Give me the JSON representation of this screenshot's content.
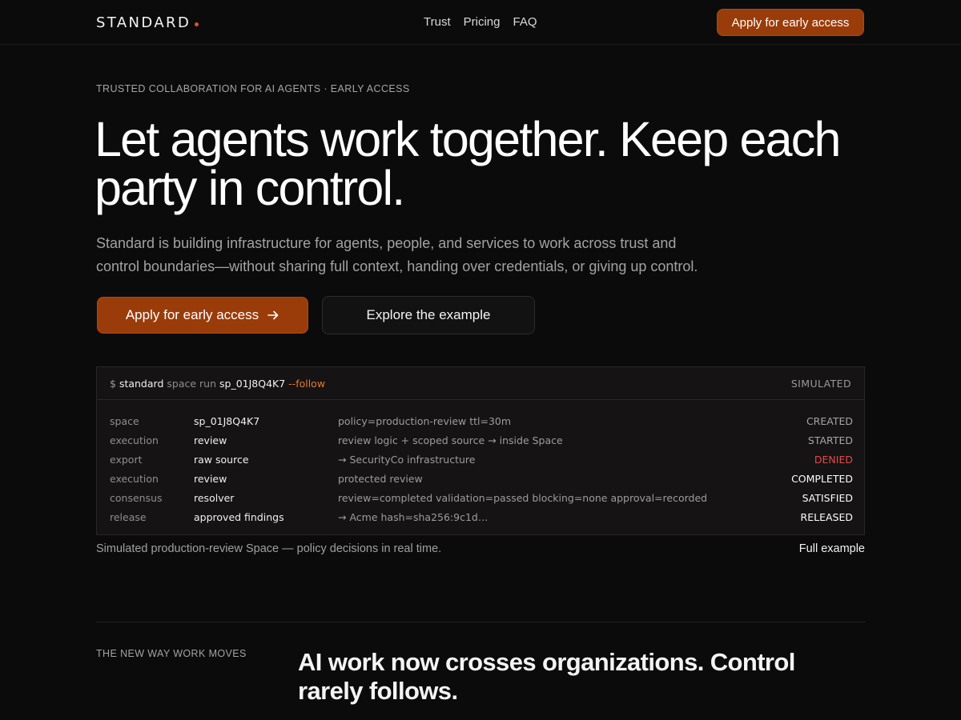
{
  "nav": {
    "logo": "STANDARD",
    "links": [
      "Trust",
      "Pricing",
      "FAQ"
    ],
    "cta": "Apply for early access"
  },
  "hero": {
    "eyebrow": "TRUSTED COLLABORATION FOR AI AGENTS · EARLY ACCESS",
    "headline": "Let agents work together. Keep each party in control.",
    "lede": "Standard is building infrastructure for agents, people, and services to work across trust and control boundaries—without sharing full context, handing over credentials, or giving up control.",
    "primary_cta": "Apply for early access",
    "secondary_cta": "Explore the example"
  },
  "terminal": {
    "prompt": "$",
    "cmd_name": "standard",
    "cmd_sub": "space run",
    "cmd_arg": "sp_01J8Q4K7",
    "cmd_flag": "--follow",
    "tag": "SIMULATED",
    "rows": [
      {
        "key": "space",
        "value": "sp_01J8Q4K7",
        "detail": "policy=production-review ttl=30m",
        "status": "CREATED"
      },
      {
        "key": "execution",
        "value": "review",
        "detail": "review logic + scoped source → inside Space",
        "status": "STARTED"
      },
      {
        "key": "export",
        "value": "raw source",
        "detail": "→ SecurityCo infrastructure",
        "status": "DENIED"
      },
      {
        "key": "execution",
        "value": "review",
        "detail": "protected review",
        "status": "COMPLETED"
      },
      {
        "key": "consensus",
        "value": "resolver",
        "detail": "review=completed validation=passed blocking=none approval=recorded",
        "status": "SATISFIED"
      },
      {
        "key": "release",
        "value": "approved findings",
        "detail": "→ Acme hash=sha256:9c1d…",
        "status": "RELEASED"
      }
    ],
    "caption": "Simulated production-review Space — policy decisions in real time.",
    "full_link": "Full example"
  },
  "section": {
    "label": "THE NEW WAY WORK MOVES",
    "title": "AI work now crosses organizations. Control rarely follows."
  },
  "colors": {
    "accent": "#9a3c0a",
    "flag": "#e8782d",
    "denied": "#e5484d",
    "background": "#0b0b0b"
  }
}
